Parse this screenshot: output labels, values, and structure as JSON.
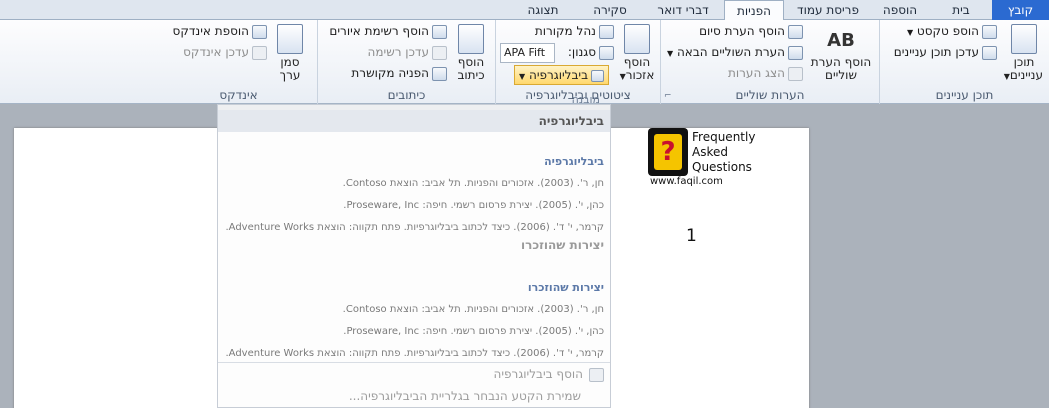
{
  "tabs": [
    "קובץ",
    "בית",
    "הוספה",
    "פריסת עמוד",
    "הפניות",
    "דברי דואר",
    "סקירה",
    "תצוגה"
  ],
  "ribbon": {
    "toc": {
      "label": "תוכן עניינים",
      "big": "תוכן עניינים",
      "add_text": "הוספ טקסט",
      "update_toc": "עדכן תוכן עניינים"
    },
    "footnotes": {
      "label": "הערות שוליים",
      "insert_endnote": "הוסף הערת סיום",
      "next_footnote": "הערת השוליים הבאה",
      "show_notes": "הצג הערות",
      "big": "הוסף הערת שוליים",
      "big_icon_text": "AB"
    },
    "citations": {
      "label": "ציטוטים וביבליוגרפיה",
      "big": "הוסף אזכור",
      "manage_sources": "נהל מקורות",
      "style_label": "סגנון:",
      "style_value": "APA Fift",
      "bibliography": "ביבליוגרפיה"
    },
    "captions": {
      "label": "כיתובים",
      "insert_figures": "הוסף רשימת איורים",
      "update_table": "עדכן רשימה",
      "cross_reference": "הפניה מקושרת",
      "big": "הוסף כיתוב"
    },
    "index": {
      "label": "אינדקס",
      "insert_index": "הוספת אינדקס",
      "update_index": "עדכן אינדקס",
      "big": "סמן ערך"
    },
    "overlay_label": "מובנה"
  },
  "menu": {
    "header": "ביבליוגרפיה",
    "sections": [
      {
        "title": "ביבליוגרפיה",
        "lines": [
          "חן, ר'. (2003). אזכורים והפניות. תל אביב: הוצאת Contoso.",
          "כהן, י'. (2005). יצירת פרסום רשמי. חיפה: Proseware, Inc.",
          "קרמר, י' ד'. (2006). כיצד לכתוב ביבליוגרפיות. פתח תקווה: הוצאת Adventure Works."
        ]
      },
      {
        "title": "יצירות שהוזכרו",
        "lines": [
          "חן, ר'. (2003). אזכורים והפניות. תל אביב: הוצאת Contoso.",
          "כהן, י'. (2005). יצירת פרסום רשמי. חיפה: Proseware, Inc.",
          "קרמר, י' ד'. (2006). כיצד לכתוב ביבליוגרפיות. פתח תקווה: הוצאת Adventure Works."
        ]
      }
    ],
    "separator_title": "יצירות שהוזכרו",
    "insert_bibliography": "הוסף ביבליוגרפיה",
    "save_selection": "שמירת הקטע הנבחר בגלריית הביבליוגרפיה..."
  },
  "logo": {
    "line1": "Frequently",
    "line2": "Asked",
    "line3": "Questions",
    "url": "www.faqil.com",
    "symbol": "?"
  },
  "document": {
    "page_number": "1"
  },
  "colors": {
    "file_tab": "#2b6ad1",
    "bibliography_highlight": "#ffd86e"
  }
}
